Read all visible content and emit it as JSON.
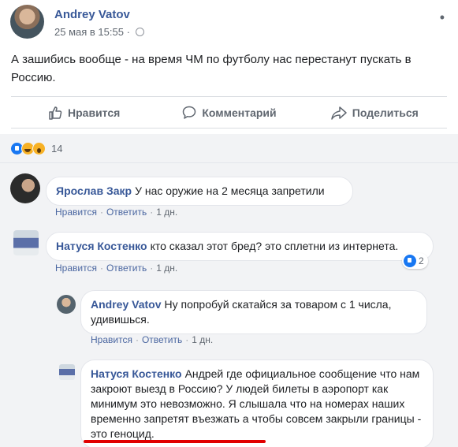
{
  "post": {
    "author": "Andrey Vatov",
    "date": "25 мая в 15:55",
    "separator": " · ",
    "text": "А зашибись вообще - на время ЧМ по футболу нас перестанут пускать в Россию."
  },
  "actions": {
    "like": "Нравится",
    "comment": "Комментарий",
    "share": "Поделиться"
  },
  "reactions": {
    "count": "14"
  },
  "comment_actions": {
    "like": "Нравится",
    "reply": "Ответить"
  },
  "comments": [
    {
      "name": "Ярослав Закр",
      "text": "У нас оружие на 2 месяца запретили",
      "time": "1 дн."
    },
    {
      "name": "Натуся Костенко",
      "text": "кто сказал этот бред? это сплетни из интернета.",
      "time": "1 дн.",
      "reactions": "2"
    },
    {
      "name": "Andrey Vatov",
      "text": "Ну попробуй скатайся за товаром с 1 числа, удивишься.",
      "time": "1 дн."
    },
    {
      "name": "Натуся Костенко",
      "text": "Андрей где официальное сообщение что нам закроют выезд в Россию? У людей билеты в аэропорт как минимум это невозможно. Я слышала что на номерах наших временно запретят въезжать а чтобы совсем закрыли границы - это геноцид."
    }
  ],
  "colors": {
    "link": "#385898",
    "accent_blue": "#1877f2",
    "highlight_underline": "#e10000",
    "comments_bg": "#f2f3f5"
  },
  "icons": [
    "globe-icon",
    "more-icon",
    "like-icon",
    "comment-icon",
    "share-icon",
    "like-reaction-icon",
    "haha-reaction-icon",
    "wow-reaction-icon"
  ]
}
